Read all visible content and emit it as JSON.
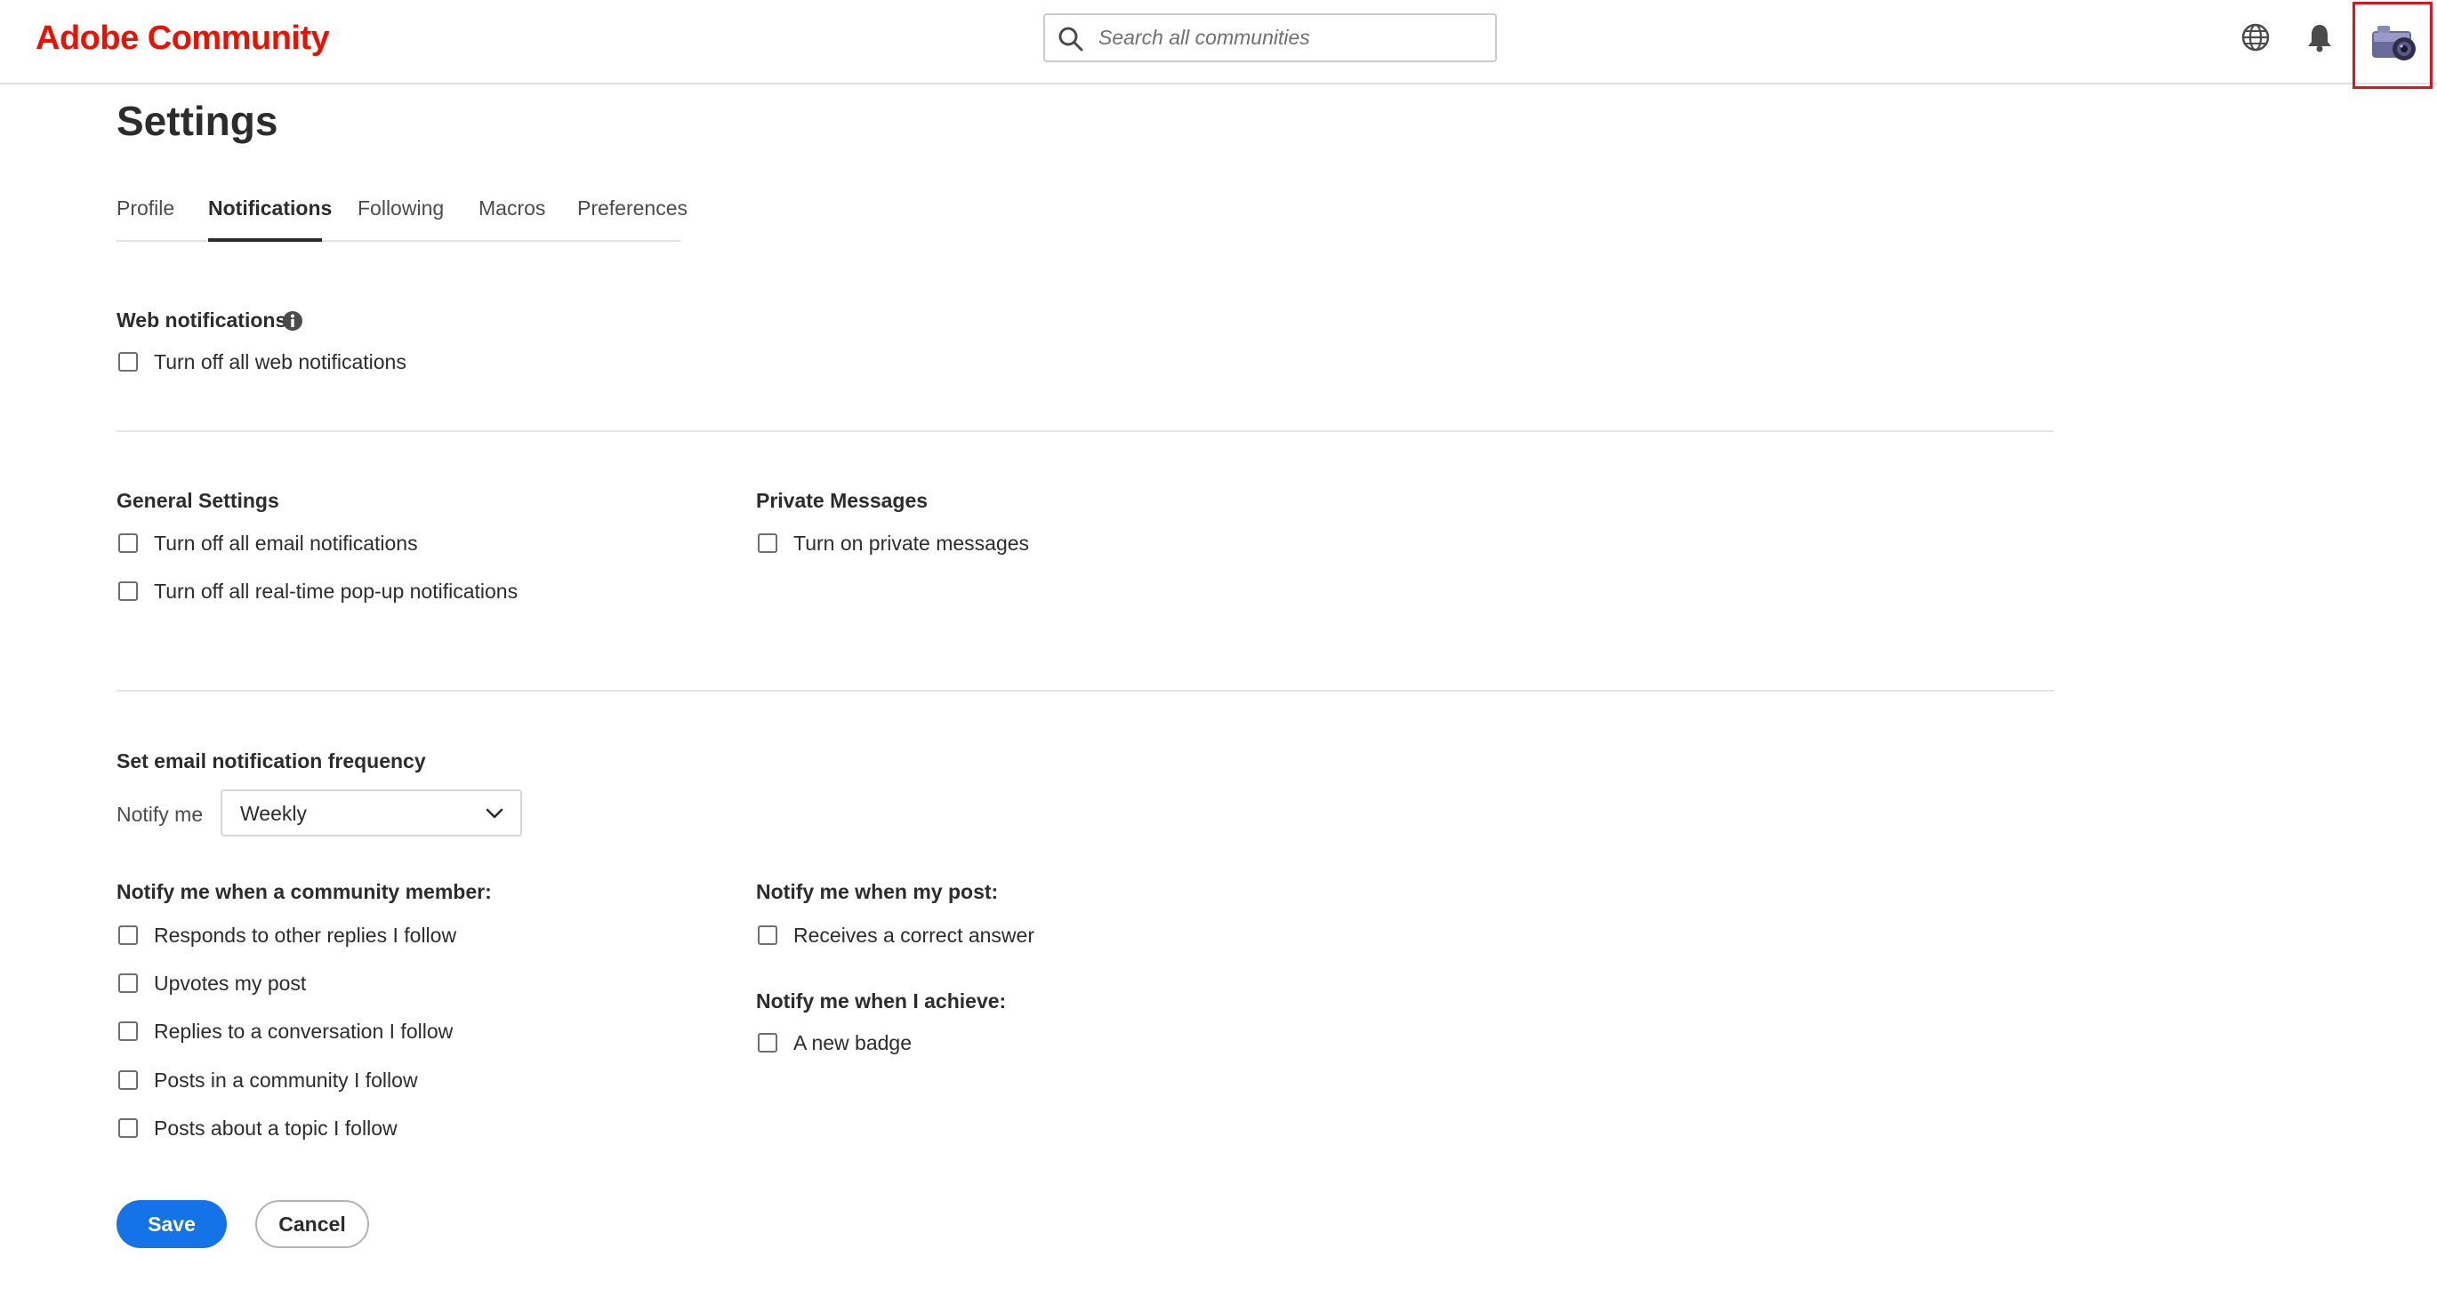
{
  "header": {
    "logo": "Adobe Community",
    "search_placeholder": "Search all communities",
    "icons": [
      "search-icon",
      "globe-icon",
      "bell-icon",
      "avatar-camera-icon"
    ],
    "highlight_color": "#e0121a"
  },
  "page": {
    "title": "Settings",
    "tabs": [
      {
        "label": "Profile",
        "active": false
      },
      {
        "label": "Notifications",
        "active": true
      },
      {
        "label": "Following",
        "active": false
      },
      {
        "label": "Macros",
        "active": false
      },
      {
        "label": "Preferences",
        "active": false
      }
    ]
  },
  "web_notifications": {
    "heading": "Web notifications",
    "options": [
      {
        "label": "Turn off all web notifications",
        "checked": false
      }
    ]
  },
  "general_settings": {
    "heading": "General Settings",
    "options": [
      {
        "label": "Turn off all email notifications",
        "checked": false
      },
      {
        "label": "Turn off all real-time pop-up notifications",
        "checked": false
      }
    ]
  },
  "private_messages": {
    "heading": "Private Messages",
    "options": [
      {
        "label": "Turn on private messages",
        "checked": false
      }
    ]
  },
  "email_frequency": {
    "heading": "Set email notification frequency",
    "notify_label": "Notify me",
    "selected": "Weekly"
  },
  "community_member": {
    "heading": "Notify me when a community member:",
    "options": [
      {
        "label": "Responds to other replies I follow",
        "checked": false
      },
      {
        "label": "Upvotes my post",
        "checked": false
      },
      {
        "label": "Replies to a conversation I follow",
        "checked": false
      },
      {
        "label": "Posts in a community I follow",
        "checked": false
      },
      {
        "label": "Posts about a topic I follow",
        "checked": false
      }
    ]
  },
  "my_post": {
    "heading": "Notify me when my post:",
    "options": [
      {
        "label": "Receives a correct answer",
        "checked": false
      }
    ]
  },
  "achieve": {
    "heading": "Notify me when I achieve:",
    "options": [
      {
        "label": "A new badge",
        "checked": false
      }
    ]
  },
  "actions": {
    "save": "Save",
    "cancel": "Cancel"
  },
  "colors": {
    "brand": "#eb1000",
    "primary_button": "#1473e6"
  }
}
